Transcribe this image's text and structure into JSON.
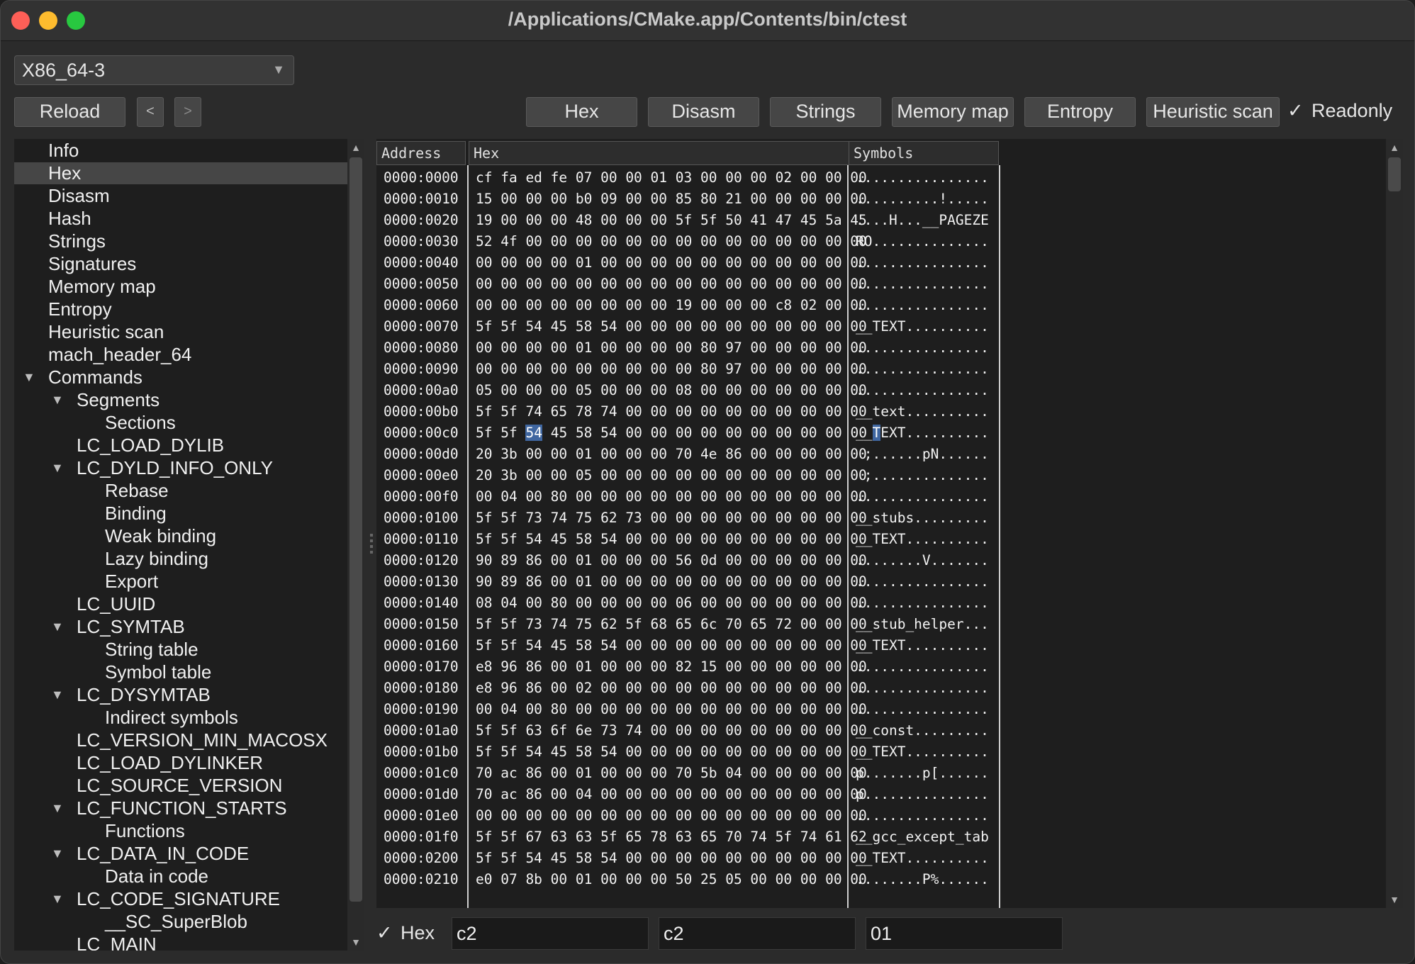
{
  "window": {
    "title": "/Applications/CMake.app/Contents/bin/ctest"
  },
  "arch_select": {
    "value": "X86_64-3"
  },
  "toolbar": {
    "reload": "Reload",
    "back": "<",
    "forward": ">",
    "hex": "Hex",
    "disasm": "Disasm",
    "strings": "Strings",
    "memory_map": "Memory map",
    "entropy": "Entropy",
    "heuristic_scan": "Heuristic scan",
    "readonly": "Readonly",
    "readonly_check": "✓"
  },
  "tree": [
    {
      "label": "Info"
    },
    {
      "label": "Hex",
      "selected": true
    },
    {
      "label": "Disasm"
    },
    {
      "label": "Hash"
    },
    {
      "label": "Strings"
    },
    {
      "label": "Signatures"
    },
    {
      "label": "Memory map"
    },
    {
      "label": "Entropy"
    },
    {
      "label": "Heuristic scan"
    },
    {
      "label": "mach_header_64"
    },
    {
      "label": "Commands",
      "expanded": true
    },
    {
      "label": "Segments",
      "expanded": true
    },
    {
      "label": "Sections"
    },
    {
      "label": "LC_LOAD_DYLIB"
    },
    {
      "label": "LC_DYLD_INFO_ONLY",
      "expanded": true
    },
    {
      "label": "Rebase"
    },
    {
      "label": "Binding"
    },
    {
      "label": "Weak binding"
    },
    {
      "label": "Lazy binding"
    },
    {
      "label": "Export"
    },
    {
      "label": "LC_UUID"
    },
    {
      "label": "LC_SYMTAB",
      "expanded": true
    },
    {
      "label": "String table"
    },
    {
      "label": "Symbol table"
    },
    {
      "label": "LC_DYSYMTAB",
      "expanded": true
    },
    {
      "label": "Indirect symbols"
    },
    {
      "label": "LC_VERSION_MIN_MACOSX"
    },
    {
      "label": "LC_LOAD_DYLINKER"
    },
    {
      "label": "LC_SOURCE_VERSION"
    },
    {
      "label": "LC_FUNCTION_STARTS",
      "expanded": true
    },
    {
      "label": "Functions"
    },
    {
      "label": "LC_DATA_IN_CODE",
      "expanded": true
    },
    {
      "label": "Data in code"
    },
    {
      "label": "LC_CODE_SIGNATURE",
      "expanded": true
    },
    {
      "label": "__SC_SuperBlob"
    },
    {
      "label": "LC_MAIN"
    }
  ],
  "hex_view": {
    "headers": {
      "address": "Address",
      "hex": "Hex",
      "symbols": "Symbols"
    },
    "rows": [
      {
        "addr": "0000:0000",
        "hex": "cf fa ed fe 07 00 00 01 03 00 00 00 02 00 00 00",
        "sym": "................"
      },
      {
        "addr": "0000:0010",
        "hex": "15 00 00 00 b0 09 00 00 85 80 21 00 00 00 00 00",
        "sym": "..........!....."
      },
      {
        "addr": "0000:0020",
        "hex": "19 00 00 00 48 00 00 00 5f 5f 50 41 47 45 5a 45",
        "sym": "....H...__PAGEZE"
      },
      {
        "addr": "0000:0030",
        "hex": "52 4f 00 00 00 00 00 00 00 00 00 00 00 00 00 00",
        "sym": "RO.............."
      },
      {
        "addr": "0000:0040",
        "hex": "00 00 00 00 01 00 00 00 00 00 00 00 00 00 00 00",
        "sym": "................"
      },
      {
        "addr": "0000:0050",
        "hex": "00 00 00 00 00 00 00 00 00 00 00 00 00 00 00 00",
        "sym": "................"
      },
      {
        "addr": "0000:0060",
        "hex": "00 00 00 00 00 00 00 00 19 00 00 00 c8 02 00 00",
        "sym": "................"
      },
      {
        "addr": "0000:0070",
        "hex": "5f 5f 54 45 58 54 00 00 00 00 00 00 00 00 00 00",
        "sym": "__TEXT.........."
      },
      {
        "addr": "0000:0080",
        "hex": "00 00 00 00 01 00 00 00 00 80 97 00 00 00 00 00",
        "sym": "................"
      },
      {
        "addr": "0000:0090",
        "hex": "00 00 00 00 00 00 00 00 00 80 97 00 00 00 00 00",
        "sym": "................"
      },
      {
        "addr": "0000:00a0",
        "hex": "05 00 00 00 05 00 00 00 08 00 00 00 00 00 00 00",
        "sym": "................"
      },
      {
        "addr": "0000:00b0",
        "hex": "5f 5f 74 65 78 74 00 00 00 00 00 00 00 00 00 00",
        "sym": "__text.........."
      },
      {
        "addr": "0000:00c0",
        "hex": "5f 5f 54 45 58 54 00 00 00 00 00 00 00 00 00 00",
        "sym": "__TEXT..........",
        "highlight_hex_index": 2,
        "highlight_sym_index": 2
      },
      {
        "addr": "0000:00d0",
        "hex": "20 3b 00 00 01 00 00 00 70 4e 86 00 00 00 00 00",
        "sym": " ;......pN......"
      },
      {
        "addr": "0000:00e0",
        "hex": "20 3b 00 00 05 00 00 00 00 00 00 00 00 00 00 00",
        "sym": " ;.............."
      },
      {
        "addr": "0000:00f0",
        "hex": "00 04 00 80 00 00 00 00 00 00 00 00 00 00 00 00",
        "sym": "................"
      },
      {
        "addr": "0000:0100",
        "hex": "5f 5f 73 74 75 62 73 00 00 00 00 00 00 00 00 00",
        "sym": "__stubs........."
      },
      {
        "addr": "0000:0110",
        "hex": "5f 5f 54 45 58 54 00 00 00 00 00 00 00 00 00 00",
        "sym": "__TEXT.........."
      },
      {
        "addr": "0000:0120",
        "hex": "90 89 86 00 01 00 00 00 56 0d 00 00 00 00 00 00",
        "sym": "........V......."
      },
      {
        "addr": "0000:0130",
        "hex": "90 89 86 00 01 00 00 00 00 00 00 00 00 00 00 00",
        "sym": "................"
      },
      {
        "addr": "0000:0140",
        "hex": "08 04 00 80 00 00 00 00 06 00 00 00 00 00 00 00",
        "sym": "................"
      },
      {
        "addr": "0000:0150",
        "hex": "5f 5f 73 74 75 62 5f 68 65 6c 70 65 72 00 00 00",
        "sym": "__stub_helper..."
      },
      {
        "addr": "0000:0160",
        "hex": "5f 5f 54 45 58 54 00 00 00 00 00 00 00 00 00 00",
        "sym": "__TEXT.........."
      },
      {
        "addr": "0000:0170",
        "hex": "e8 96 86 00 01 00 00 00 82 15 00 00 00 00 00 00",
        "sym": "................"
      },
      {
        "addr": "0000:0180",
        "hex": "e8 96 86 00 02 00 00 00 00 00 00 00 00 00 00 00",
        "sym": "................"
      },
      {
        "addr": "0000:0190",
        "hex": "00 04 00 80 00 00 00 00 00 00 00 00 00 00 00 00",
        "sym": "................"
      },
      {
        "addr": "0000:01a0",
        "hex": "5f 5f 63 6f 6e 73 74 00 00 00 00 00 00 00 00 00",
        "sym": "__const........."
      },
      {
        "addr": "0000:01b0",
        "hex": "5f 5f 54 45 58 54 00 00 00 00 00 00 00 00 00 00",
        "sym": "__TEXT.........."
      },
      {
        "addr": "0000:01c0",
        "hex": "70 ac 86 00 01 00 00 00 70 5b 04 00 00 00 00 00",
        "sym": "p.......p[......"
      },
      {
        "addr": "0000:01d0",
        "hex": "70 ac 86 00 04 00 00 00 00 00 00 00 00 00 00 00",
        "sym": "p..............."
      },
      {
        "addr": "0000:01e0",
        "hex": "00 00 00 00 00 00 00 00 00 00 00 00 00 00 00 00",
        "sym": "................"
      },
      {
        "addr": "0000:01f0",
        "hex": "5f 5f 67 63 63 5f 65 78 63 65 70 74 5f 74 61 62",
        "sym": "__gcc_except_tab"
      },
      {
        "addr": "0000:0200",
        "hex": "5f 5f 54 45 58 54 00 00 00 00 00 00 00 00 00 00",
        "sym": "__TEXT.........."
      },
      {
        "addr": "0000:0210",
        "hex": "e0 07 8b 00 01 00 00 00 50 25 05 00 00 00 00 00",
        "sym": "........P%......"
      }
    ]
  },
  "status_bar": {
    "hex_check": "✓",
    "hex_label": "Hex",
    "field1": "c2",
    "field2": "c2",
    "field3": "01"
  }
}
